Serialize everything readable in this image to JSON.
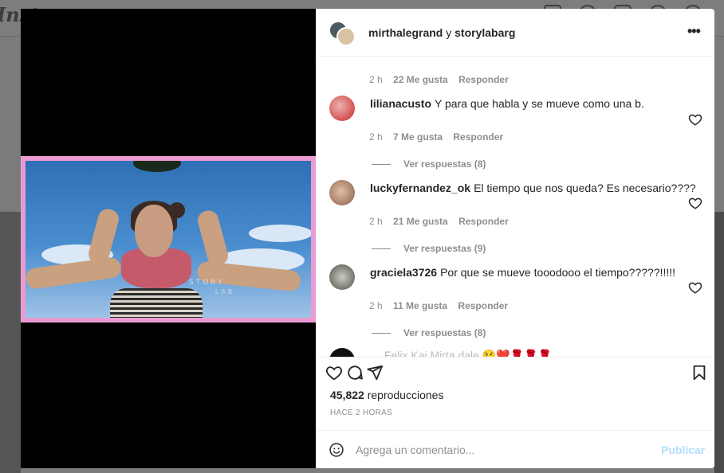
{
  "background": {
    "logo": "Inst"
  },
  "post": {
    "header_user1": "mirthalegrand",
    "header_joiner": " y ",
    "header_user2": "storylabarg",
    "more_icon": "more-horizontal-icon",
    "watermark1": "STORY",
    "watermark2": "LAB"
  },
  "comments": {
    "first_meta": {
      "time": "2 h",
      "likes": "22 Me gusta",
      "reply": "Responder"
    },
    "items": [
      {
        "user": "lilianacusto",
        "text": "Y para que habla y se mueve como una b.",
        "time": "2 h",
        "likes": "7 Me gusta",
        "reply": "Responder",
        "view_replies": "Ver respuestas (8)",
        "avatar_color": "#d23a3a"
      },
      {
        "user": "luckyfernandez_ok",
        "text": "El tiempo que nos queda? Es necesario????",
        "time": "2 h",
        "likes": "21 Me gusta",
        "reply": "Responder",
        "view_replies": "Ver respuestas (9)",
        "avatar_color": "#b5826a"
      },
      {
        "user": "graciela3726",
        "text": "Por que se mueve tooodooo el tiempo?????!!!!!",
        "time": "2 h",
        "likes": "11 Me gusta",
        "reply": "Responder",
        "view_replies": "Ver respuestas (8)",
        "avatar_color": "#6b6f62"
      }
    ],
    "partial_text": "… Felix Kai Mirta dale 😢❤️🌹🌹🌹"
  },
  "actions": {
    "views_count": "45,822",
    "views_label": " reproducciones",
    "time_ago": "HACE 2 HORAS"
  },
  "composer": {
    "placeholder": "Agrega un comentario...",
    "post_label": "Publicar"
  }
}
